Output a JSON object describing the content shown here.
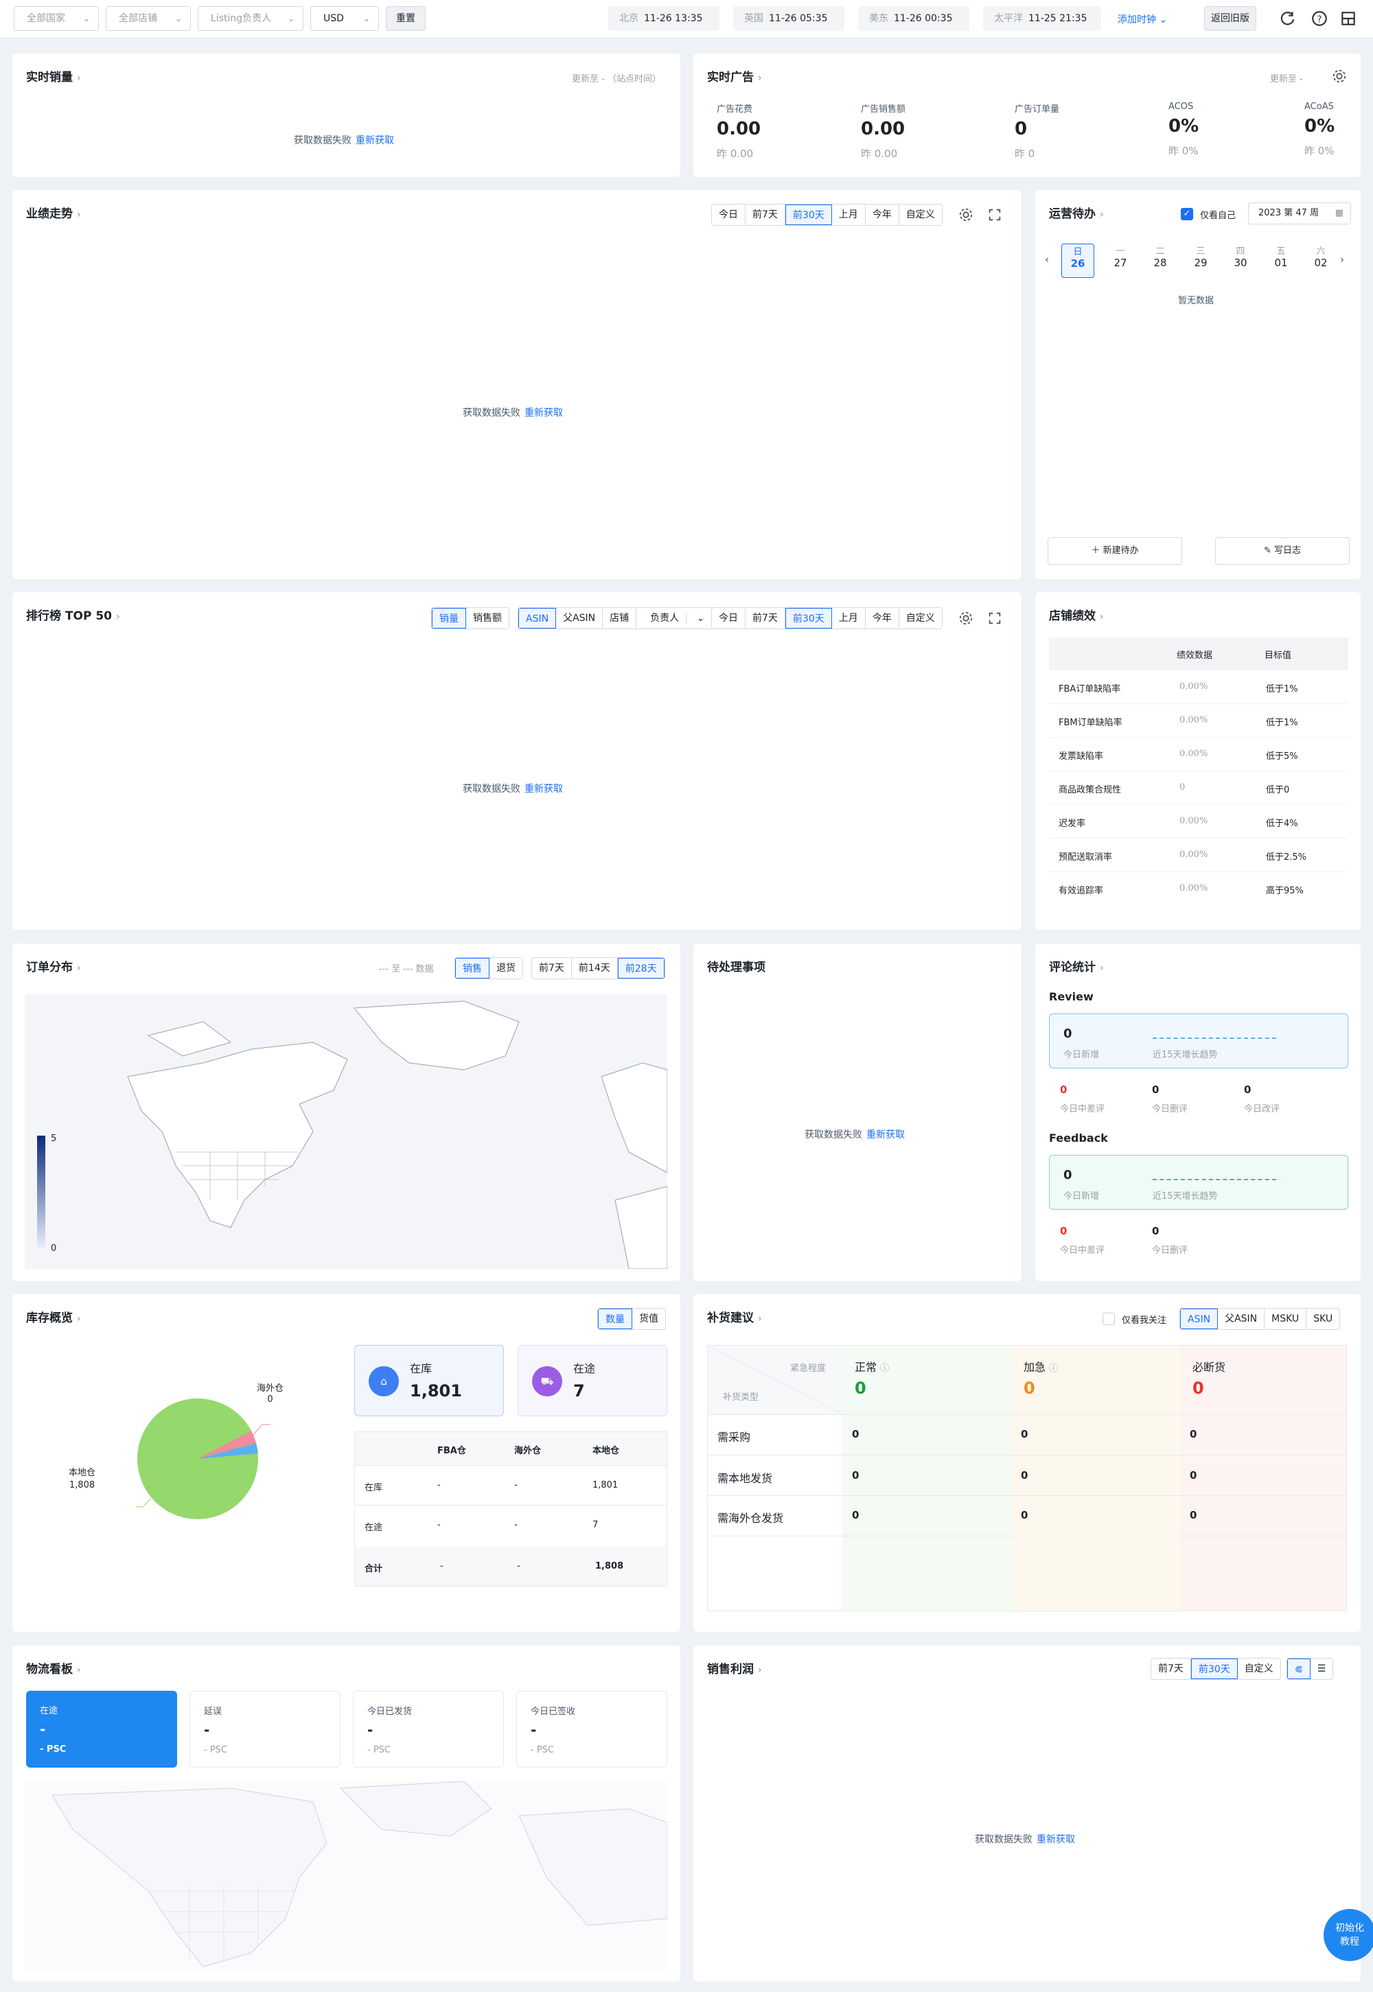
{
  "topbar": {
    "country": "全部国家",
    "shop": "全部店铺",
    "listing_owner": "Listing负责人",
    "currency": "USD",
    "reset": "重置",
    "clocks": [
      {
        "zone": "北京",
        "time": "11-26 13:35"
      },
      {
        "zone": "英国",
        "time": "11-26 05:35"
      },
      {
        "zone": "美东",
        "time": "11-26 00:35"
      },
      {
        "zone": "太平洋",
        "time": "11-25 21:35"
      }
    ],
    "add_clock": "添加时钟",
    "old_version": "返回旧版"
  },
  "common": {
    "error": "获取数据失败",
    "retry": "重新获取",
    "empty": "暂无数据"
  },
  "realtime_sales": {
    "title": "实时销量",
    "update": "更新至 - （站点时间）"
  },
  "realtime_ads": {
    "title": "实时广告",
    "update": "更新至 -",
    "metrics": [
      {
        "label": "广告花费",
        "value": "0.00",
        "yesterday": "昨 0.00"
      },
      {
        "label": "广告销售额",
        "value": "0.00",
        "yesterday": "昨 0.00"
      },
      {
        "label": "广告订单量",
        "value": "0",
        "yesterday": "昨 0"
      },
      {
        "label": "ACOS",
        "value": "0%",
        "yesterday": "昨 0%"
      },
      {
        "label": "ACoAS",
        "value": "0%",
        "yesterday": "昨 0%"
      }
    ]
  },
  "perf_trend": {
    "title": "业绩走势",
    "ranges": [
      "今日",
      "前7天",
      "前30天",
      "上月",
      "今年",
      "自定义"
    ]
  },
  "ops_todo": {
    "title": "运营待办",
    "only_me": "仅看自己",
    "week": "2023 第 47 周",
    "days": [
      {
        "wd": "日",
        "d": "26"
      },
      {
        "wd": "一",
        "d": "27"
      },
      {
        "wd": "二",
        "d": "28"
      },
      {
        "wd": "三",
        "d": "29"
      },
      {
        "wd": "四",
        "d": "30"
      },
      {
        "wd": "五",
        "d": "01"
      },
      {
        "wd": "六",
        "d": "02"
      }
    ],
    "new_todo": "新建待办",
    "write_log": "写日志"
  },
  "ranking": {
    "title": "排行榜 TOP 50",
    "metric": [
      "销量",
      "销售额"
    ],
    "dim": [
      "ASIN",
      "父ASIN",
      "店铺",
      "负责人"
    ],
    "ranges": [
      "今日",
      "前7天",
      "前30天",
      "上月",
      "今年",
      "自定义"
    ]
  },
  "shop_perf": {
    "title": "店铺绩效",
    "headers": [
      "绩效数据",
      "目标值"
    ],
    "rows": [
      {
        "name": "FBA订单缺陷率",
        "value": "0.00%",
        "target": "低于1%"
      },
      {
        "name": "FBM订单缺陷率",
        "value": "0.00%",
        "target": "低于1%"
      },
      {
        "name": "发票缺陷率",
        "value": "0.00%",
        "target": "低于5%"
      },
      {
        "name": "商品政策合规性",
        "value": "0",
        "target": "低于0"
      },
      {
        "name": "迟发率",
        "value": "0.00%",
        "target": "低于4%"
      },
      {
        "name": "预配送取消率",
        "value": "0.00%",
        "target": "低于2.5%"
      },
      {
        "name": "有效追踪率",
        "value": "0.00%",
        "target": "高于95%"
      }
    ]
  },
  "order_dist": {
    "title": "订单分布",
    "range_text": "--- 至 --- 数据",
    "type": [
      "销售",
      "退货"
    ],
    "ranges": [
      "前7天",
      "前14天",
      "前28天"
    ],
    "legend_max": "5",
    "legend_min": "0"
  },
  "pending": {
    "title": "待处理事项"
  },
  "reviews": {
    "title": "评论统计",
    "review_label": "Review",
    "feedback_label": "Feedback",
    "review": {
      "new": "0",
      "new_label": "今日新增",
      "trend_label": "近15天增长趋势",
      "bad": "0",
      "bad_label": "今日中差评",
      "deleted": "0",
      "deleted_label": "今日删评",
      "changed": "0",
      "changed_label": "今日改评"
    },
    "feedback": {
      "new": "0",
      "new_label": "今日新增",
      "trend_label": "近15天增长趋势",
      "bad": "0",
      "bad_label": "今日中差评",
      "deleted": "0",
      "deleted_label": "今日删评"
    }
  },
  "inventory": {
    "title": "库存概览",
    "toggle": [
      "数量",
      "货值"
    ],
    "in_stock_label": "在库",
    "in_stock": "1,801",
    "in_transit_label": "在途",
    "in_transit": "7",
    "pie_labels": {
      "overseas": "海外仓",
      "overseas_val": "0",
      "local": "本地仓",
      "local_val": "1,808"
    },
    "table": {
      "headers": [
        "FBA仓",
        "海外仓",
        "本地仓"
      ],
      "rows": [
        {
          "name": "在库",
          "fba": "-",
          "overseas": "-",
          "local": "1,801"
        },
        {
          "name": "在途",
          "fba": "-",
          "overseas": "-",
          "local": "7"
        },
        {
          "name": "合计",
          "fba": "-",
          "overseas": "-",
          "local": "1,808"
        }
      ]
    }
  },
  "restock": {
    "title": "补货建议",
    "only_follow": "仅看我关注",
    "dims": [
      "ASIN",
      "父ASIN",
      "MSKU",
      "SKU"
    ],
    "corner_top": "紧急程度",
    "corner_bottom": "补货类型",
    "cols": [
      {
        "label": "正常",
        "value": "0",
        "color": "#1a9e3f"
      },
      {
        "label": "加急",
        "value": "0",
        "color": "#f08c1a"
      },
      {
        "label": "必断货",
        "value": "0",
        "color": "#e8332f"
      }
    ],
    "rows": [
      {
        "name": "需采购",
        "v": [
          "0",
          "0",
          "0"
        ]
      },
      {
        "name": "需本地发货",
        "v": [
          "0",
          "0",
          "0"
        ]
      },
      {
        "name": "需海外仓发货",
        "v": [
          "0",
          "0",
          "0"
        ]
      }
    ]
  },
  "logistics": {
    "title": "物流看板",
    "tiles": [
      {
        "label": "在途",
        "value": "-",
        "unit": "- PSC"
      },
      {
        "label": "延误",
        "value": "-",
        "unit": "- PSC"
      },
      {
        "label": "今日已发货",
        "value": "-",
        "unit": "- PSC"
      },
      {
        "label": "今日已签收",
        "value": "-",
        "unit": "- PSC"
      }
    ]
  },
  "profit": {
    "title": "销售利润",
    "ranges": [
      "前7天",
      "前30天",
      "自定义"
    ]
  },
  "tutorial": {
    "line1": "初始化",
    "line2": "教程"
  },
  "colors": {
    "accent": "#1b6ff3",
    "background": "#eef1f6"
  }
}
